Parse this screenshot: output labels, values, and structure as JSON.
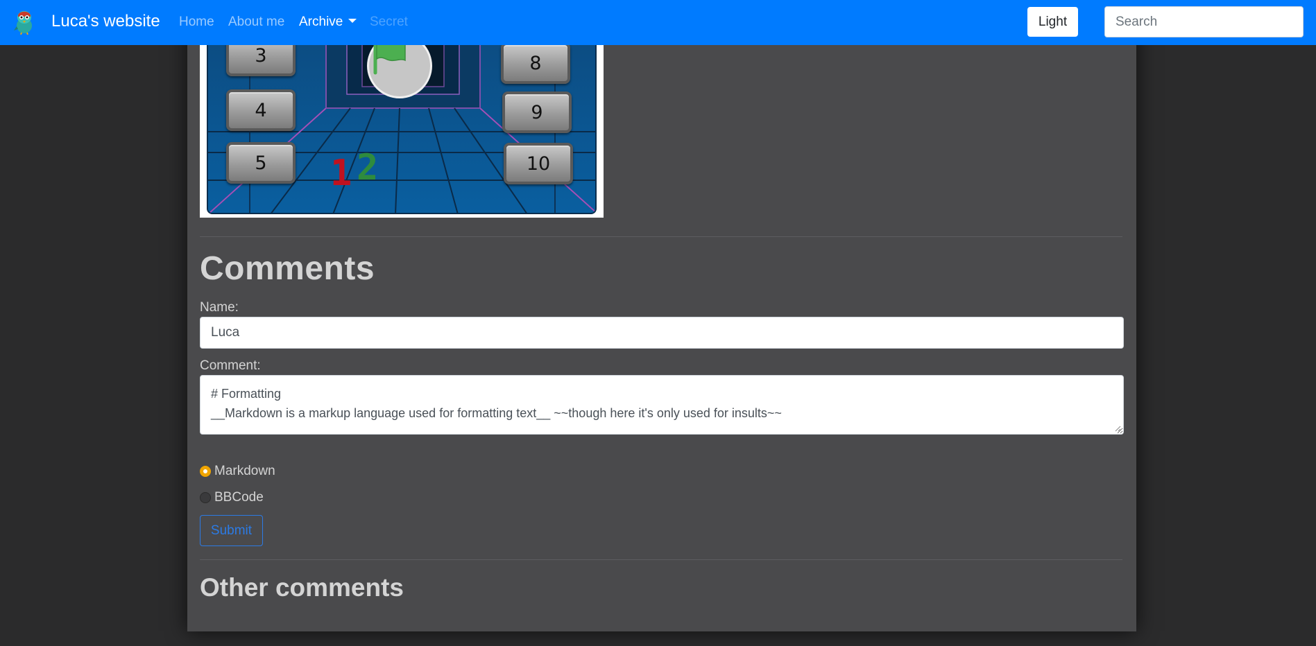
{
  "navbar": {
    "brand": "Luca's website",
    "links": [
      {
        "label": "Home"
      },
      {
        "label": "About me"
      },
      {
        "label": "Archive"
      },
      {
        "label": "Secret"
      }
    ],
    "theme_button": "Light",
    "search_placeholder": "Search",
    "logo_icon": "bird-mascot-icon"
  },
  "game": {
    "left_buttons": [
      "3",
      "4",
      "5"
    ],
    "right_buttons": [
      "8",
      "9",
      "10"
    ],
    "flag_icon": "green-flag-icon",
    "score_red": "1",
    "score_green": "2",
    "colors": {
      "red": "#c1121f",
      "green": "#2e8b3e",
      "board": "#0a3f6f",
      "neon": "#c85cd6"
    }
  },
  "comments": {
    "heading": "Comments",
    "name_label": "Name:",
    "name_value": "Luca",
    "comment_label": "Comment:",
    "comment_line1": "# Formatting",
    "comment_line2": "__Markdown is a markup language used for formatting text__ ~~though here it's only used for insults~~",
    "format_options": [
      {
        "label": "Markdown",
        "checked": true
      },
      {
        "label": "BBCode",
        "checked": false
      }
    ],
    "submit_label": "Submit"
  },
  "other_comments": {
    "heading": "Other comments"
  },
  "colors": {
    "navbar": "#007bff",
    "page_bg": "#2b2b2c",
    "card_bg": "#4a4a4c",
    "radio_accent": "#f0a500",
    "submit": "#2c7be5"
  }
}
